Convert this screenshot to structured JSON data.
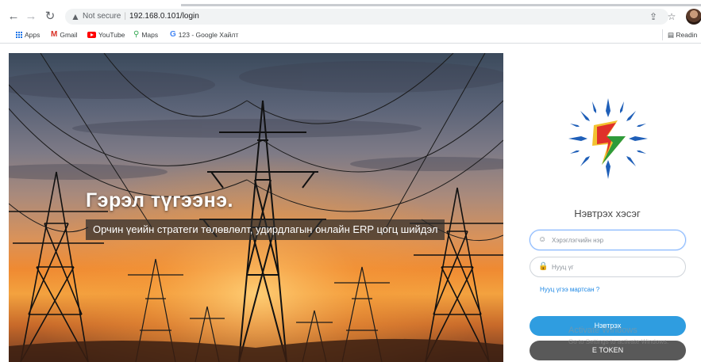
{
  "browser": {
    "security_label": "Not secure",
    "url": "192.168.0.101/login",
    "bookmarks": [
      {
        "label": "Apps",
        "icon": "apps-grid-icon"
      },
      {
        "label": "Gmail",
        "icon": "gmail-icon"
      },
      {
        "label": "YouTube",
        "icon": "youtube-icon"
      },
      {
        "label": "Maps",
        "icon": "maps-icon"
      },
      {
        "label": "123 - Google Хайлт",
        "icon": "google-icon"
      }
    ],
    "reading_list_label": "Readin"
  },
  "hero": {
    "title": "Гэрэл түгээнэ.",
    "subtitle": "Орчин үеийн стратеги төлөвлөлт, удирдлагын онлайн ERP цогц шийдэл"
  },
  "login": {
    "title": "Нэвтрэх хэсэг",
    "username_placeholder": "Хэрэглэгчийн нэр",
    "password_placeholder": "Нууц үг",
    "forgot_link": "Нууц үгээ мартсан ?",
    "login_button": "Нэвтрэх",
    "token_button": "Е TOKEN"
  },
  "watermark": {
    "line1": "Activate Windows",
    "line2": "Go to Settings to activate Windows."
  },
  "colors": {
    "primary_button": "#2f9de0",
    "token_button": "#595959",
    "link": "#1e88e5",
    "logo_green": "#2e9b3a",
    "logo_red": "#e0302a",
    "logo_yellow": "#f2c230",
    "logo_blue": "#1f5fb8"
  }
}
